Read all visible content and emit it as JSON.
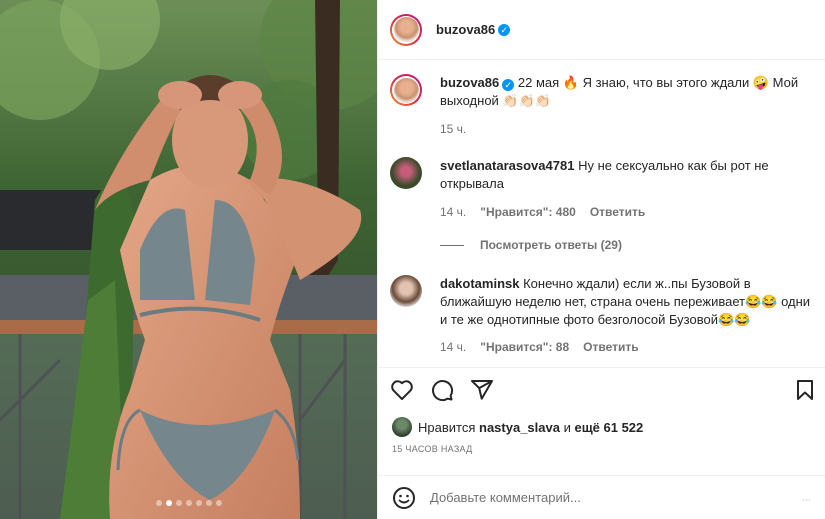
{
  "post": {
    "author": "buzova86",
    "verified": true,
    "caption": {
      "date": "22 мая",
      "text": "🔥 Я знаю, что вы этого ждали 🤪 Мой выходной 👏🏻👏🏻👏🏻",
      "time": "15 ч."
    },
    "carousel": {
      "count": 7,
      "active_index": 1
    }
  },
  "comments": [
    {
      "user": "svetlanatarasova4781",
      "text": "Ну не сексуально как бы рот не открывала",
      "time": "14 ч.",
      "likes_label": "\"Нравится\": 480",
      "reply_label": "Ответить"
    },
    {
      "user": "dakotaminsk",
      "text": "Конечно ждали) если ж..пы Бузовой в ближайшую неделю нет, страна очень переживает😂😂 одни и те же однотипные фото безголосой Бузовой😂😂",
      "time": "14 ч.",
      "likes_label": "\"Нравится\": 88",
      "reply_label": "Ответить"
    }
  ],
  "view_replies": "Посмотреть ответы (29)",
  "likes": {
    "prefix": "Нравится",
    "user": "nastya_slava",
    "middle": "и",
    "count": "ещё 61 522"
  },
  "timestamp": "15 ЧАСОВ НАЗАД",
  "add_comment": {
    "placeholder": "Добавьте комментарий...",
    "post_label": "..."
  },
  "icons": {
    "like": "heart-icon",
    "comment": "comment-icon",
    "share": "share-icon",
    "save": "bookmark-icon",
    "emoji": "emoji-icon",
    "verified": "verified-badge-icon"
  },
  "colors": {
    "verified": "#0095f6",
    "text": "#262626",
    "muted": "#737373"
  }
}
